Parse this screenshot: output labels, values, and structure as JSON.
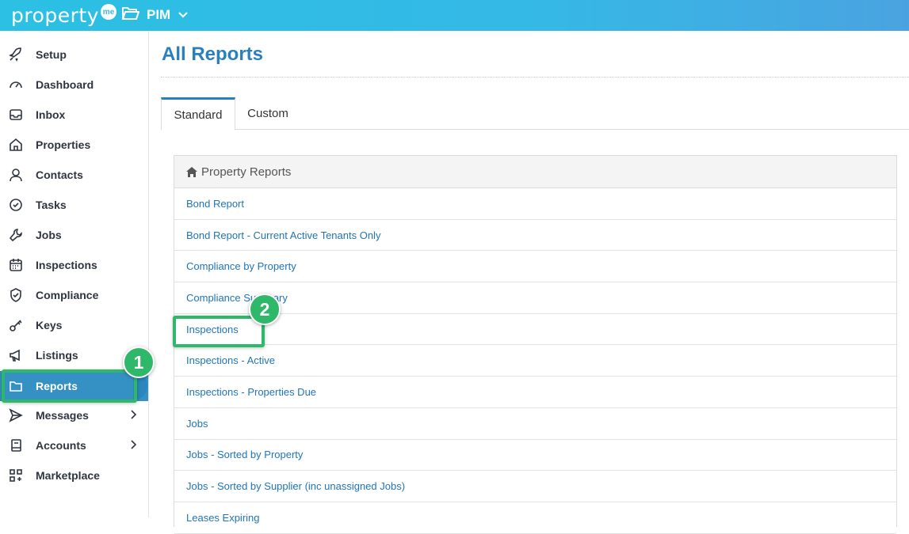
{
  "header": {
    "logo_text": "property",
    "logo_badge": "me",
    "portfolio_label": "PIM"
  },
  "sidebar": {
    "items": [
      {
        "label": "Setup",
        "icon": "rocket-icon"
      },
      {
        "label": "Dashboard",
        "icon": "gauge-icon"
      },
      {
        "label": "Inbox",
        "icon": "inbox-icon"
      },
      {
        "label": "Properties",
        "icon": "home-icon"
      },
      {
        "label": "Contacts",
        "icon": "person-icon"
      },
      {
        "label": "Tasks",
        "icon": "check-circle-icon"
      },
      {
        "label": "Jobs",
        "icon": "wrench-icon"
      },
      {
        "label": "Inspections",
        "icon": "calendar-icon"
      },
      {
        "label": "Compliance",
        "icon": "shield-check-icon"
      },
      {
        "label": "Keys",
        "icon": "key-icon"
      },
      {
        "label": "Listings",
        "icon": "megaphone-icon"
      },
      {
        "label": "Reports",
        "icon": "folder-icon",
        "active": true
      },
      {
        "label": "Messages",
        "icon": "send-icon",
        "has_submenu": true
      },
      {
        "label": "Accounts",
        "icon": "ledger-icon",
        "has_submenu": true
      },
      {
        "label": "Marketplace",
        "icon": "apps-icon"
      }
    ]
  },
  "main": {
    "title": "All Reports",
    "tabs": [
      {
        "label": "Standard",
        "active": true
      },
      {
        "label": "Custom",
        "active": false
      }
    ],
    "panel": {
      "title": "Property Reports",
      "reports": [
        "Bond Report",
        "Bond Report - Current Active Tenants Only",
        "Compliance by Property",
        "Compliance Summary",
        "Inspections",
        "Inspections - Active",
        "Inspections - Properties Due",
        "Jobs",
        "Jobs - Sorted by Property",
        "Jobs - Sorted by Supplier (inc unassigned Jobs)",
        "Leases Expiring"
      ]
    }
  },
  "annotations": {
    "step1": "1",
    "step2": "2"
  },
  "colors": {
    "brand_blue": "#2a7fc1",
    "active_nav": "#3591c4",
    "highlight_green": "#2fb86a"
  }
}
